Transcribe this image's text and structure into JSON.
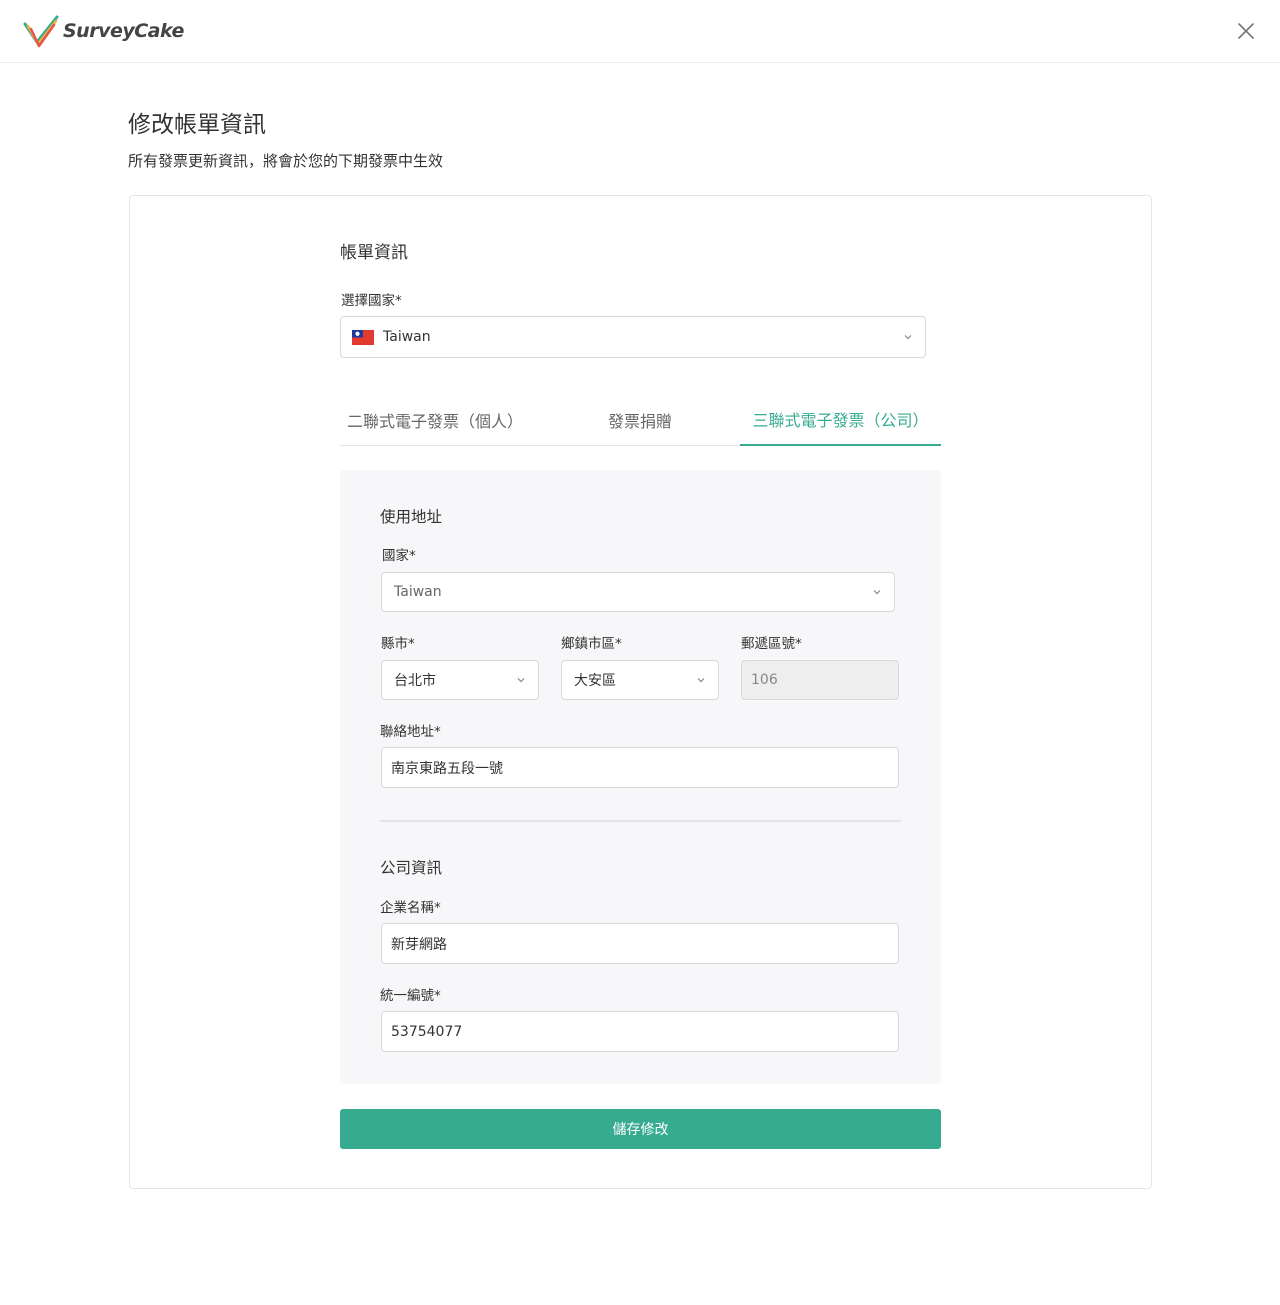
{
  "brand": {
    "name": "SurveyCake"
  },
  "page": {
    "title": "修改帳單資訊",
    "subtitle": "所有發票更新資訊，將會於您的下期發票中生效"
  },
  "billing": {
    "section_title": "帳單資訊",
    "country_label": "選擇國家*",
    "country_value": "Taiwan"
  },
  "tabs": [
    {
      "label": "二聯式電子發票（個人）",
      "active": false
    },
    {
      "label": "發票捐贈",
      "active": false
    },
    {
      "label": "三聯式電子發票（公司）",
      "active": true
    }
  ],
  "address": {
    "section_title": "使用地址",
    "country_label": "國家*",
    "country_value": "Taiwan",
    "city_label": "縣市*",
    "city_value": "台北市",
    "district_label": "鄉鎮市區*",
    "district_value": "大安區",
    "zip_label": "郵遞區號*",
    "zip_value": "106",
    "street_label": "聯絡地址*",
    "street_value": "南京東路五段一號"
  },
  "company": {
    "section_title": "公司資訊",
    "name_label": "企業名稱*",
    "name_value": "新芽網路",
    "tax_id_label": "統一編號*",
    "tax_id_value": "53754077"
  },
  "actions": {
    "save_label": "儲存修改"
  },
  "colors": {
    "accent": "#37ab90",
    "panel_bg": "#f7f7f9"
  },
  "icons": {
    "close": "close-icon",
    "chevron": "chevron-down-icon",
    "flag": "taiwan-flag-icon"
  }
}
